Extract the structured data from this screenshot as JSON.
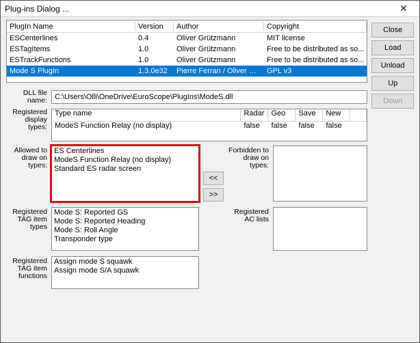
{
  "window": {
    "title": "Plug-ins Dialog ..."
  },
  "buttons": {
    "close": "Close",
    "load": "Load",
    "unload": "Unload",
    "up": "Up",
    "down": "Down",
    "left": "<<",
    "right": ">>"
  },
  "pluginTable": {
    "headers": {
      "name": "PlugIn Name",
      "version": "Version",
      "author": "Author",
      "copyright": "Copyright"
    },
    "rows": [
      {
        "name": "ESCenterlines",
        "version": "0.4",
        "author": "Oliver Grützmann",
        "copyright": "MIT license"
      },
      {
        "name": "ESTagItems",
        "version": "1.0",
        "author": "Oliver Grützmann",
        "copyright": "Free to be distributed as so..."
      },
      {
        "name": "ESTrackFunctions",
        "version": "1.0",
        "author": "Oliver Grützmann",
        "copyright": "Free to be distributed as so..."
      },
      {
        "name": "Mode S PlugIn",
        "version": "1.3.0e32",
        "author": "Pierre Ferran / Oliver Grütz...",
        "copyright": "GPL v3"
      }
    ]
  },
  "labels": {
    "dllFile": "DLL file name:",
    "dispTypes": "Registered display types:",
    "allowed": "Allowed to draw on types:",
    "forbidden": "Forbidden to draw on types:",
    "tagTypes": "Registered TAG item types",
    "acLists": "Registered AC lists",
    "tagFuncs": "Registered TAG item functions"
  },
  "dllPath": "C:\\Users\\Olli\\OneDrive\\EuroScope\\PlugIns\\ModeS.dll",
  "typeTable": {
    "headers": {
      "name": "Type name",
      "radar": "Radar",
      "geo": "Geo",
      "save": "Save",
      "new": "New"
    },
    "row": {
      "name": "ModeS Function Relay (no display)",
      "radar": "false",
      "geo": "false",
      "save": "false",
      "new": "false"
    }
  },
  "allowedList": [
    "ES Centerlines",
    "ModeS Function Relay (no display)",
    "Standard ES radar screen"
  ],
  "tagItemTypes": [
    "Mode S: Reported GS",
    "Mode S: Reported Heading",
    "Mode S: Roll Angle",
    "Transponder type"
  ],
  "tagItemFuncs": [
    "Assign mode S squawk",
    "Assign mode S/A squawk"
  ]
}
